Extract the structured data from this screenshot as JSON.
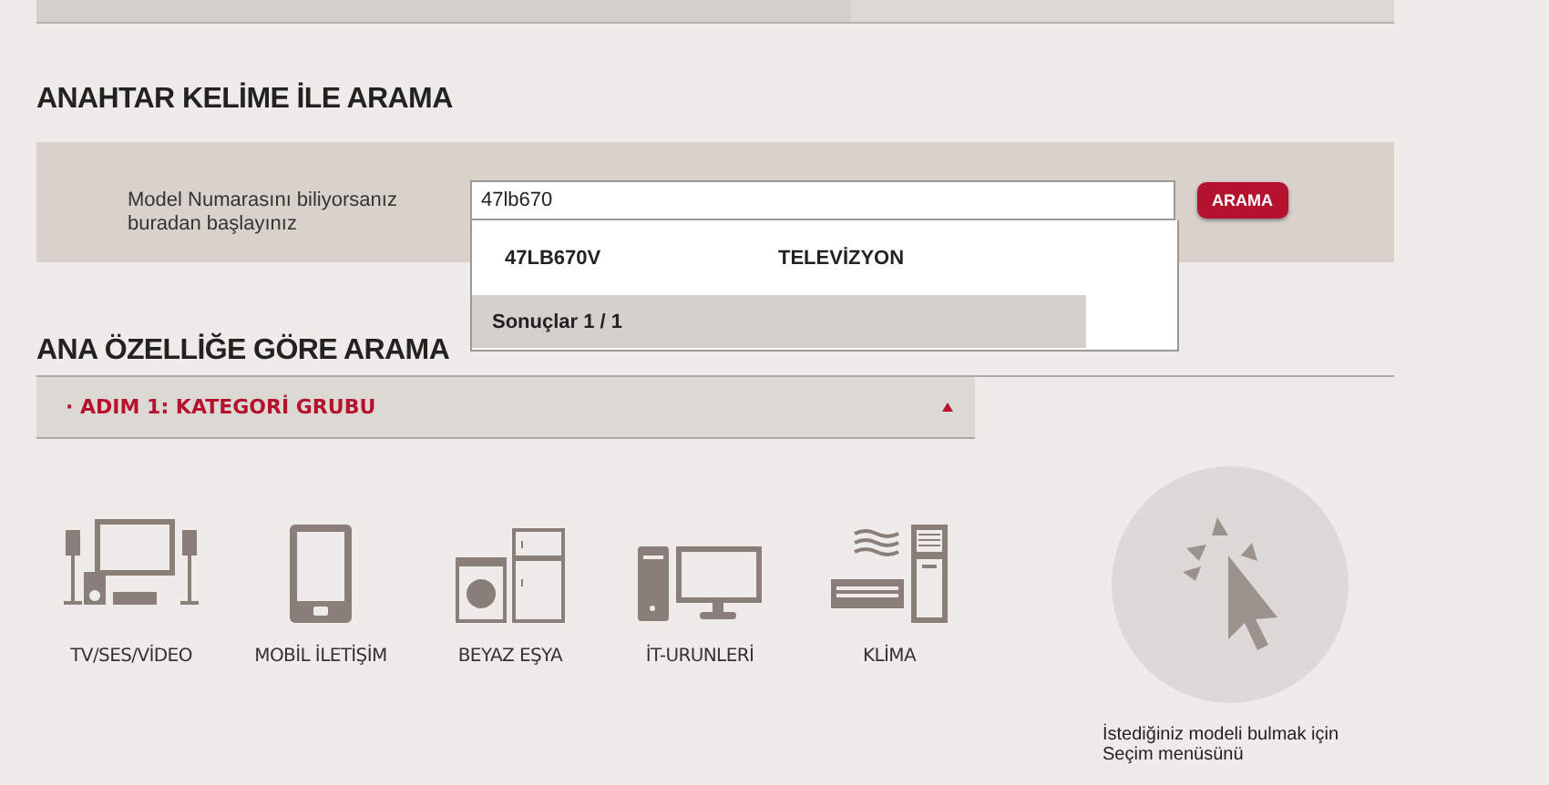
{
  "keyword_search": {
    "heading": "ANAHTAR KELİME İLE ARAMA",
    "label": "Model Numarasını biliyorsanız buradan başlayınız",
    "query": "47lb670",
    "button": "ARAMA",
    "suggestions": [
      {
        "model": "47LB670V",
        "category": "TELEVİZYON"
      }
    ],
    "results_footer": "Sonuçlar 1 / 1"
  },
  "feature_search": {
    "heading": "ANA ÖZELLİĞE GÖRE ARAMA",
    "step": {
      "bullet": "·",
      "label": "ADIM 1: KATEGORİ GRUBU",
      "expanded": true
    },
    "categories": [
      {
        "kind": "av",
        "label": "TV/SES/VİDEO"
      },
      {
        "kind": "mobile",
        "label": "MOBİL İLETİŞİM"
      },
      {
        "kind": "appliance",
        "label": "BEYAZ EŞYA"
      },
      {
        "kind": "it",
        "label": "İT-URUNLERİ"
      },
      {
        "kind": "ac",
        "label": "KLİMA"
      }
    ],
    "hint": [
      "İstediğiniz modeli bulmak için",
      "Seçim menüsünü"
    ]
  }
}
